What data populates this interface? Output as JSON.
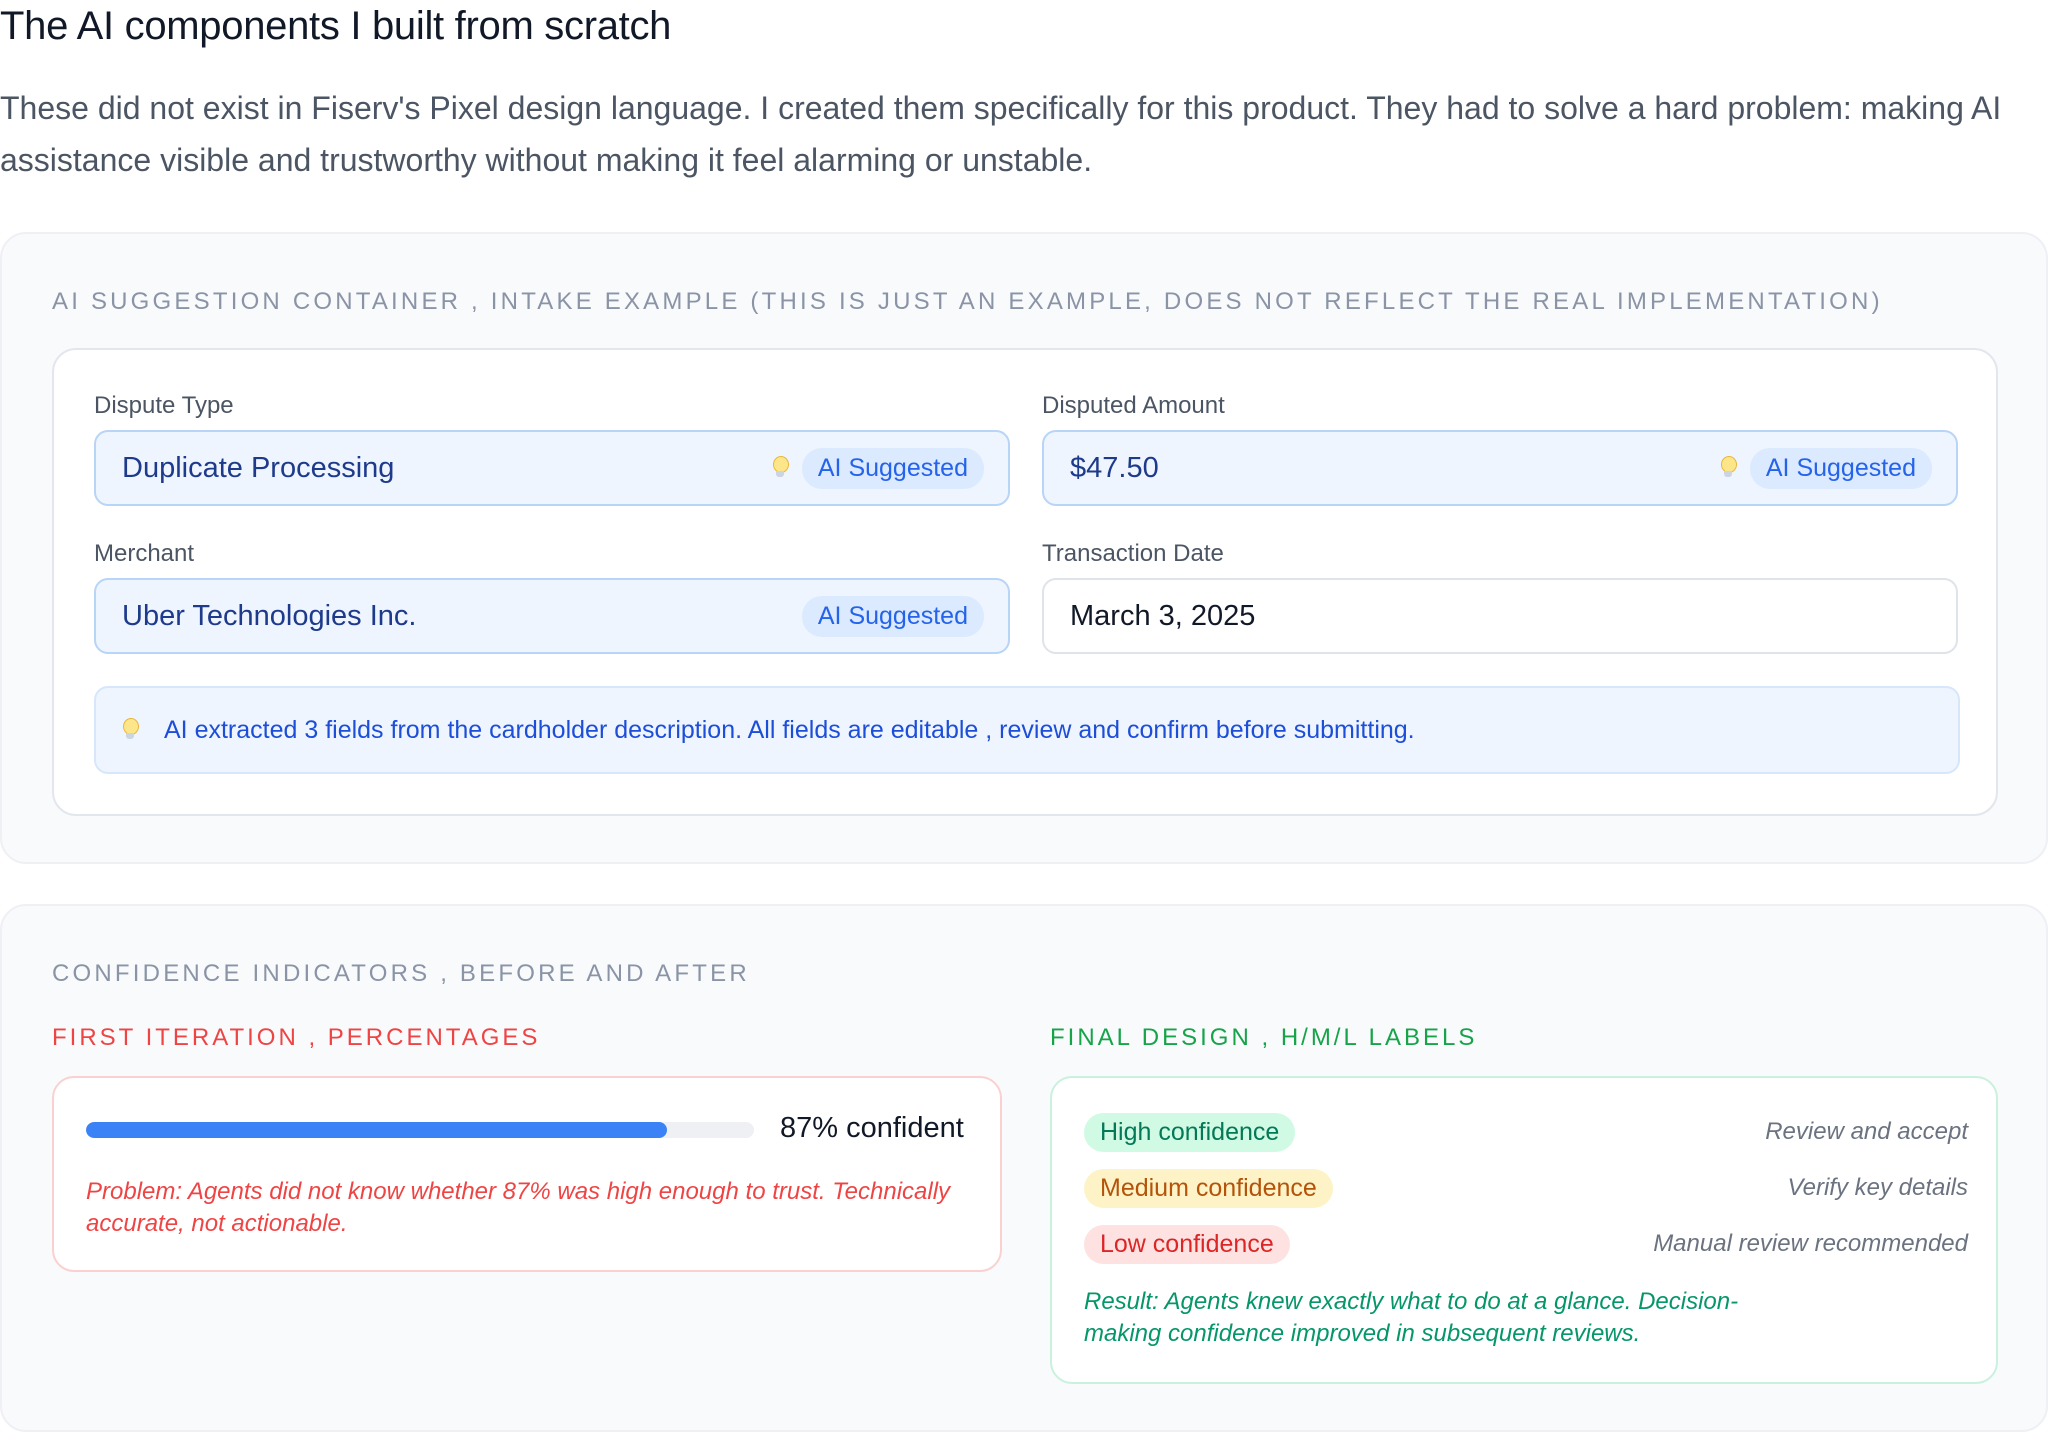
{
  "page": {
    "title": "The AI components I built from scratch",
    "intro": "These did not exist in Fiserv's Pixel design language. I created them specifically for this product. They had to solve a hard problem: making AI assistance visible and trustworthy without making it feel alarming or unstable."
  },
  "suggestion_section": {
    "label": "AI SUGGESTION CONTAINER , INTAKE EXAMPLE (THIS IS JUST AN EXAMPLE, DOES NOT REFLECT THE REAL IMPLEMENTATION)",
    "fields": [
      {
        "label": "Dispute Type",
        "value": "Duplicate Processing",
        "badge": "AI Suggested",
        "icon": "lightbulb-icon"
      },
      {
        "label": "Disputed Amount",
        "value": "$47.50",
        "badge": "AI Suggested",
        "icon": "lightbulb-icon"
      },
      {
        "label": "Merchant",
        "value": "Uber Technologies Inc.",
        "badge": "AI Suggested"
      },
      {
        "label": "Transaction Date",
        "value": "March 3, 2025"
      }
    ],
    "info": {
      "icon": "lightbulb-icon",
      "text": "AI extracted 3 fields from the cardholder description. All fields are editable , review and confirm before submitting."
    }
  },
  "confidence_section": {
    "label": "CONFIDENCE INDICATORS , BEFORE AND AFTER",
    "before": {
      "label": "FIRST ITERATION , PERCENTAGES",
      "progress_percent": 87,
      "progress_text": "87% confident",
      "note": "Problem: Agents did not know whether 87% was high enough to trust. Technically accurate, not actionable."
    },
    "after": {
      "label": "FINAL DESIGN , H/M/L LABELS",
      "levels": [
        {
          "badge": "High confidence",
          "action": "Review and accept"
        },
        {
          "badge": "Medium confidence",
          "action": "Verify key details"
        },
        {
          "badge": "Low confidence",
          "action": "Manual review recommended"
        }
      ],
      "result": "Result: Agents knew exactly what to do at a glance. Decision-making confidence improved in subsequent reviews."
    }
  },
  "colors": {
    "accent_blue": "#3b82f6",
    "ai_badge_text": "#2563eb",
    "problem_red": "#ef4444",
    "result_green": "#059669"
  }
}
